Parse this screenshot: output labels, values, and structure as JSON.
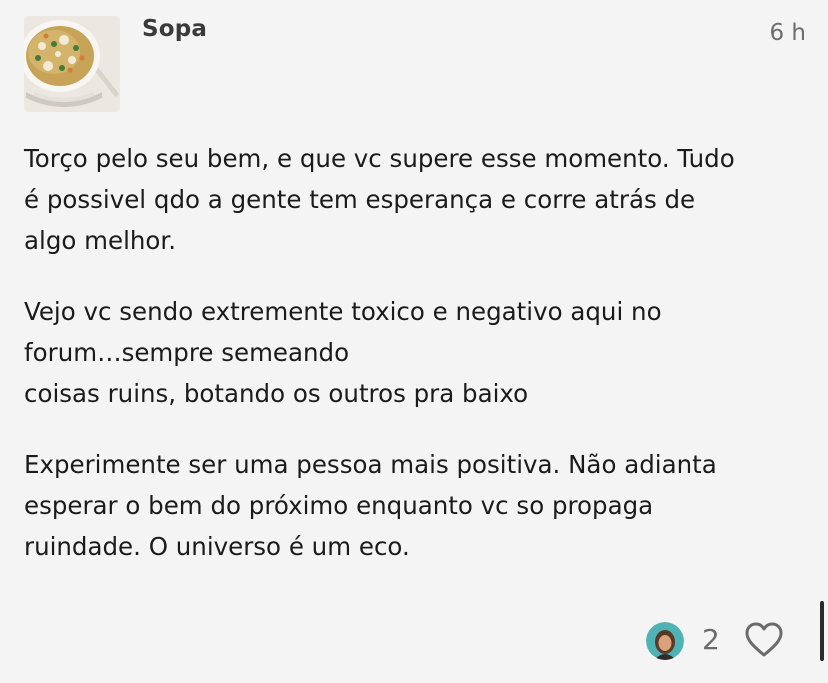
{
  "post": {
    "username": "Sopa",
    "timestamp": "6 h",
    "avatar_icon": "soup-bowl-avatar",
    "paragraphs": [
      [
        "Torço pelo seu bem, e que vc supere esse momento. Tudo",
        "é possivel qdo a gente tem esperança e corre atrás de",
        "algo melhor."
      ],
      [
        "Vejo vc sendo extremente toxico e negativo aqui no",
        "forum…sempre semeando",
        "coisas ruins, botando os outros pra baixo"
      ],
      [
        "Experimente ser uma pessoa mais positiva. Não adianta",
        "esperar o bem do próximo enquanto vc so propaga",
        "ruindade. O universo é um eco."
      ]
    ]
  },
  "footer": {
    "like_count": "2",
    "liker_avatar_icon": "user-avatar-icon",
    "like_icon": "heart-outline-icon"
  },
  "colors": {
    "background": "#f4f4f4",
    "text": "#1b1b1b",
    "muted": "#6b6b6b",
    "liker_ring": "#4fb3b5"
  }
}
